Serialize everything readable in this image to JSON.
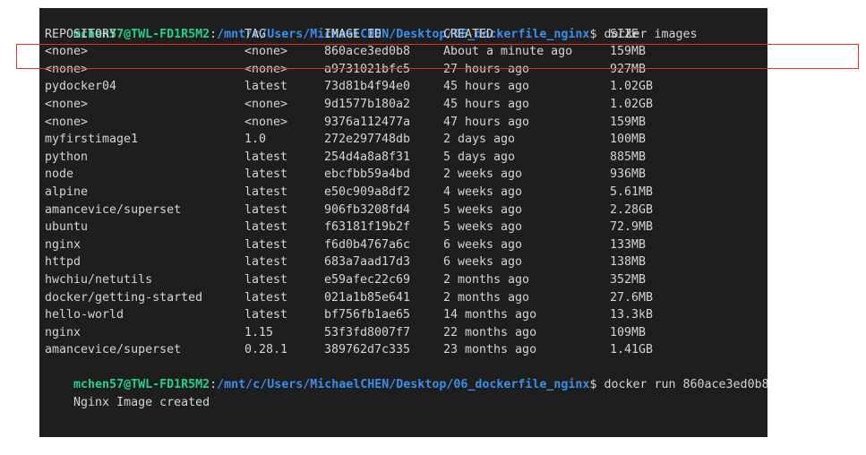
{
  "prompt": {
    "user_host": "mchen57@TWL-FD1R5M2",
    "colon": ":",
    "path": "/mnt/c/Users/MichaelCHEN/Desktop/06_dockerfile_nginx",
    "dollar": "$"
  },
  "commands": {
    "first": " docker images",
    "second": " docker run 860ace3ed0b8"
  },
  "headers": {
    "repository": "REPOSITORY",
    "tag": "TAG",
    "image_id": "IMAGE ID",
    "created": "CREATED",
    "size": "SIZE"
  },
  "images": [
    {
      "repository": "<none>",
      "tag": "<none>",
      "image_id": "860ace3ed0b8",
      "created": "About a minute ago",
      "size": "159MB"
    },
    {
      "repository": "<none>",
      "tag": "<none>",
      "image_id": "a9731021bfc5",
      "created": "27 hours ago",
      "size": "927MB"
    },
    {
      "repository": "pydocker04",
      "tag": "latest",
      "image_id": "73d81b4f94e0",
      "created": "45 hours ago",
      "size": "1.02GB"
    },
    {
      "repository": "<none>",
      "tag": "<none>",
      "image_id": "9d1577b180a2",
      "created": "45 hours ago",
      "size": "1.02GB"
    },
    {
      "repository": "<none>",
      "tag": "<none>",
      "image_id": "9376a112477a",
      "created": "47 hours ago",
      "size": "159MB"
    },
    {
      "repository": "myfirstimage1",
      "tag": "1.0",
      "image_id": "272e297748db",
      "created": "2 days ago",
      "size": "100MB"
    },
    {
      "repository": "python",
      "tag": "latest",
      "image_id": "254d4a8a8f31",
      "created": "5 days ago",
      "size": "885MB"
    },
    {
      "repository": "node",
      "tag": "latest",
      "image_id": "ebcfbb59a4bd",
      "created": "2 weeks ago",
      "size": "936MB"
    },
    {
      "repository": "alpine",
      "tag": "latest",
      "image_id": "e50c909a8df2",
      "created": "4 weeks ago",
      "size": "5.61MB"
    },
    {
      "repository": "amancevice/superset",
      "tag": "latest",
      "image_id": "906fb3208fd4",
      "created": "5 weeks ago",
      "size": "2.28GB"
    },
    {
      "repository": "ubuntu",
      "tag": "latest",
      "image_id": "f63181f19b2f",
      "created": "5 weeks ago",
      "size": "72.9MB"
    },
    {
      "repository": "nginx",
      "tag": "latest",
      "image_id": "f6d0b4767a6c",
      "created": "6 weeks ago",
      "size": "133MB"
    },
    {
      "repository": "httpd",
      "tag": "latest",
      "image_id": "683a7aad17d3",
      "created": "6 weeks ago",
      "size": "138MB"
    },
    {
      "repository": "hwchiu/netutils",
      "tag": "latest",
      "image_id": "e59afec22c69",
      "created": "2 months ago",
      "size": "352MB"
    },
    {
      "repository": "docker/getting-started",
      "tag": "latest",
      "image_id": "021a1b85e641",
      "created": "2 months ago",
      "size": "27.6MB"
    },
    {
      "repository": "hello-world",
      "tag": "latest",
      "image_id": "bf756fb1ae65",
      "created": "14 months ago",
      "size": "13.3kB"
    },
    {
      "repository": "nginx",
      "tag": "1.15",
      "image_id": "53f3fd8007f7",
      "created": "22 months ago",
      "size": "109MB"
    },
    {
      "repository": "amancevice/superset",
      "tag": "0.28.1",
      "image_id": "389762d7c335",
      "created": "23 months ago",
      "size": "1.41GB"
    }
  ],
  "output": {
    "run_result": "Nginx Image created"
  },
  "colors": {
    "background": "#1e1e1e",
    "text": "#d4d4d4",
    "prompt_user": "#23d18b",
    "prompt_path": "#3b8eea",
    "highlight_border": "#e03030"
  }
}
